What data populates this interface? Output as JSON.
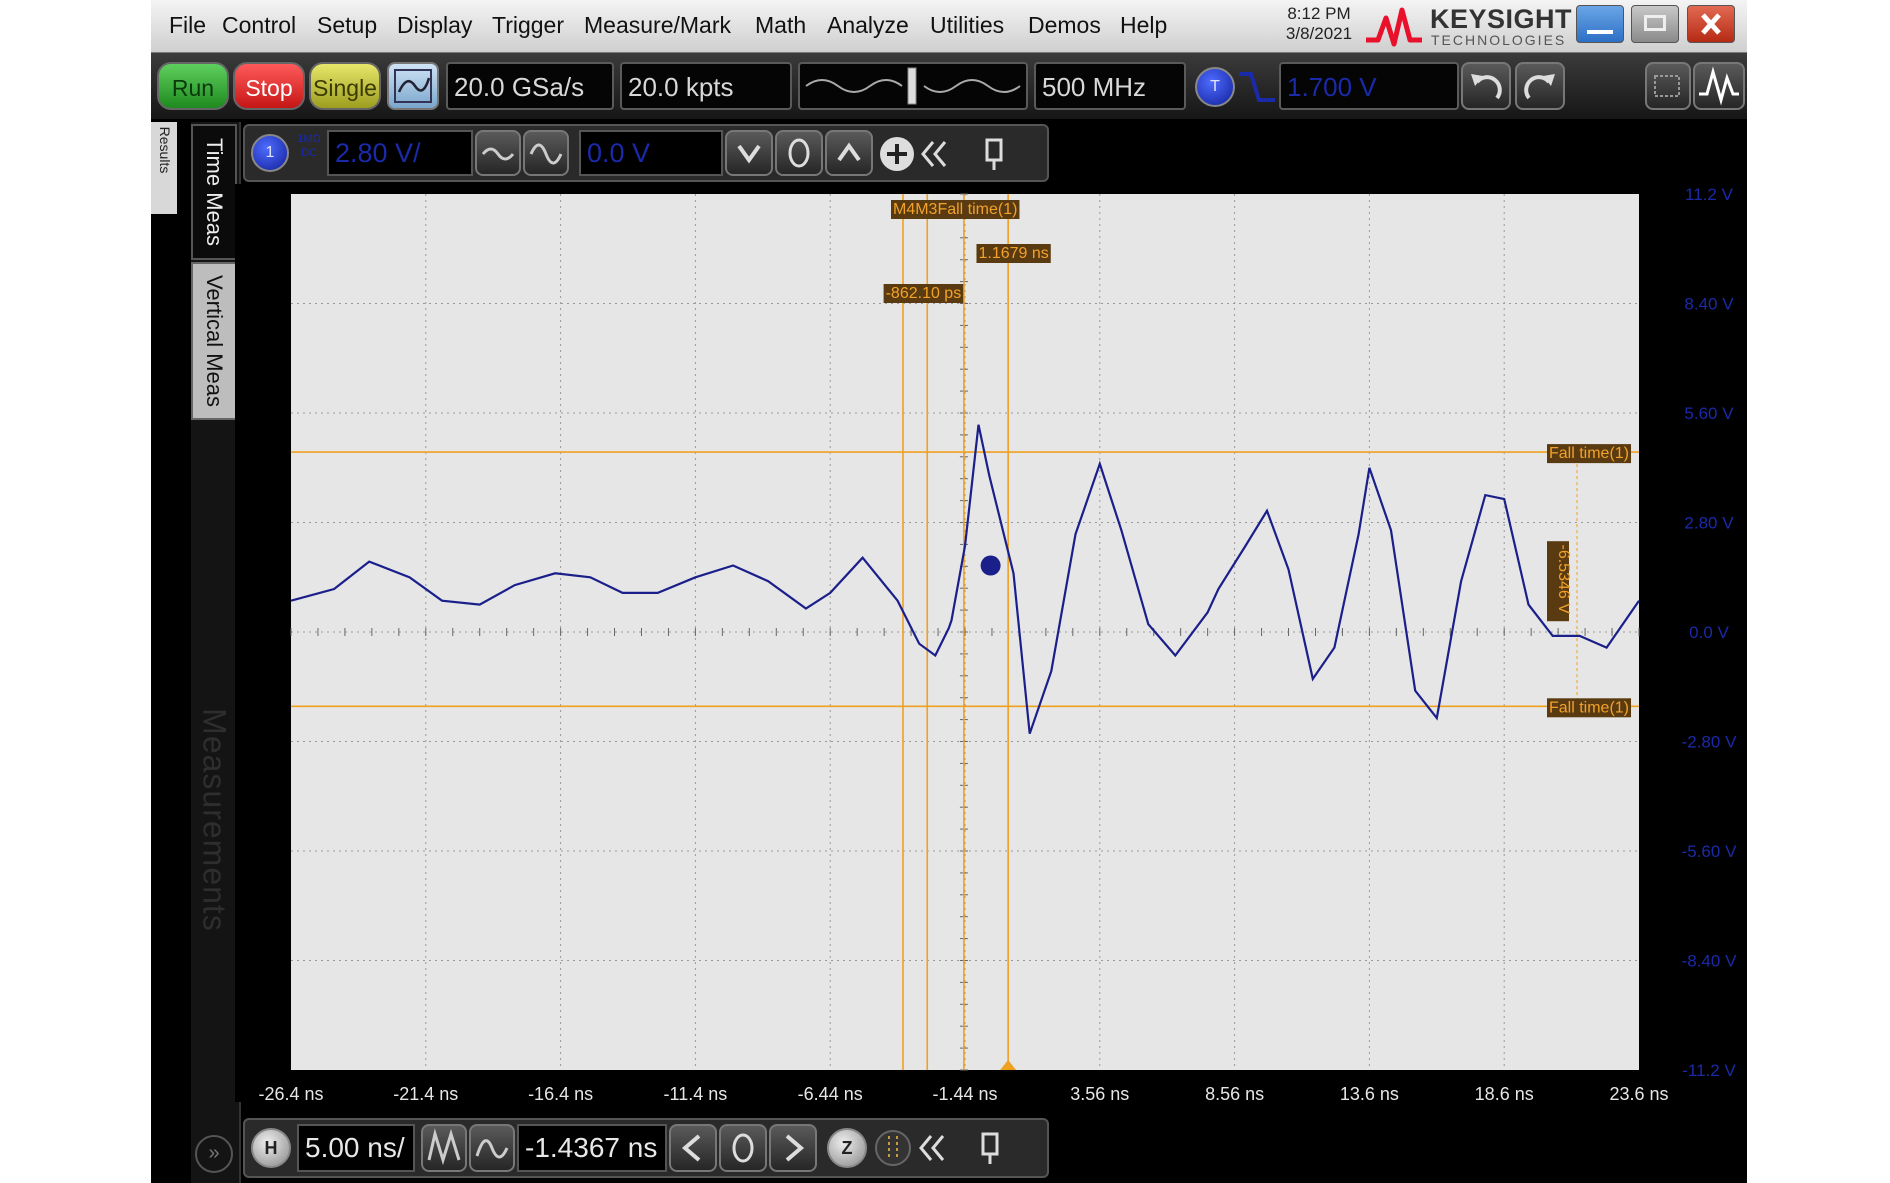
{
  "menu": [
    "File",
    "Control",
    "Setup",
    "Display",
    "Trigger",
    "Measure/Mark",
    "Math",
    "Analyze",
    "Utilities",
    "Demos",
    "Help"
  ],
  "clock": {
    "time": "8:12 PM",
    "date": "3/8/2021"
  },
  "brand": {
    "name": "KEYSIGHT",
    "sub": "TECHNOLOGIES",
    "accent": "#e8102a"
  },
  "toolbar": {
    "run_label": "Run",
    "stop_label": "Stop",
    "single_label": "Single",
    "sample_rate": "20.0 GSa/s",
    "memory_depth": "20.0 kpts",
    "bandwidth": "500 MHz",
    "trigger_source": "T",
    "trigger_level": "1.700 V"
  },
  "left_tabs": {
    "results": "Results",
    "time_meas": "Time Meas",
    "vertical_meas": "Vertical Meas",
    "measurements": "Measurements"
  },
  "channel": {
    "number": "1",
    "coupling_top": "1MΩ",
    "coupling_bottom": "DC",
    "scale": "2.80 V/",
    "offset": "0.0 V"
  },
  "horizontal": {
    "label": "H",
    "scale": "5.00 ns/",
    "position": "-1.4367 ns",
    "zoom_icon": "Z"
  },
  "plot": {
    "y_tick_labels": [
      "11.2 V",
      "8.40 V",
      "5.60 V",
      "2.80 V",
      "0.0 V",
      "-2.80 V",
      "-5.60 V",
      "-8.40 V",
      "-11.2 V"
    ],
    "x_tick_labels": [
      "-26.4 ns",
      "-21.4 ns",
      "-16.4 ns",
      "-11.4 ns",
      "-6.44 ns",
      "-1.44 ns",
      "3.56 ns",
      "8.56 ns",
      "13.6 ns",
      "18.6 ns",
      "23.6 ns"
    ],
    "marker_label": "M4M3Fall time(1)",
    "delta_time_1": "1.1679 ns",
    "delta_time_2": "-862.10 ps",
    "upper_threshold_label": "Fall time(1)",
    "lower_threshold_label": "Fall time(1)",
    "delta_voltage": "-6.5346 V",
    "colors": {
      "grid_bg": "#e6e6e6",
      "waveform": "#1a1f8a",
      "marker": "#f0a020",
      "scale_text": "#1a2aa8"
    }
  },
  "chart_data": {
    "type": "line",
    "title": "",
    "xlabel": "",
    "ylabel": "",
    "xlim": [
      -26.4,
      23.6
    ],
    "ylim": [
      -11.2,
      11.2
    ],
    "x_unit": "ns",
    "y_unit": "V",
    "grid": true,
    "series": [
      {
        "x": [
          -26.4,
          -24.8,
          -23.5,
          -22.0,
          -20.8,
          -19.4,
          -18.1,
          -16.6,
          -15.3,
          -14.1,
          -12.8,
          -11.4,
          -10.0,
          -8.7,
          -7.3,
          -6.4,
          -5.2,
          -3.9,
          -3.1,
          -2.5,
          -2.0,
          -1.9,
          -1.4,
          -0.9,
          -0.5,
          0.4,
          1.0,
          1.8,
          2.7,
          3.6,
          4.4,
          5.4,
          6.4,
          7.6,
          8.0,
          9.0,
          9.8,
          10.6,
          11.5,
          12.3,
          13.2,
          13.6,
          14.4,
          15.3,
          16.1,
          17.0,
          17.9,
          18.6,
          19.5,
          20.4,
          21.4,
          22.4,
          23.6
        ],
        "y": [
          0.8,
          1.1,
          1.8,
          1.4,
          0.8,
          0.7,
          1.2,
          1.5,
          1.4,
          1.0,
          1.0,
          1.4,
          1.7,
          1.3,
          0.6,
          1.0,
          1.9,
          0.8,
          -0.3,
          -0.6,
          0.1,
          0.3,
          2.2,
          5.3,
          4.0,
          1.5,
          -2.6,
          -1.0,
          2.5,
          4.3,
          2.6,
          0.2,
          -0.6,
          0.5,
          1.1,
          2.2,
          3.1,
          1.6,
          -1.2,
          -0.4,
          2.5,
          4.2,
          2.6,
          -1.5,
          -2.2,
          1.3,
          3.5,
          3.4,
          0.7,
          -0.1,
          -0.1,
          -0.4,
          0.8
        ]
      }
    ],
    "markers": {
      "x_cursors_ns": [
        -3.7,
        -2.8,
        -1.44,
        0.2
      ],
      "y_cursors_V": [
        4.6,
        -1.9
      ]
    }
  }
}
